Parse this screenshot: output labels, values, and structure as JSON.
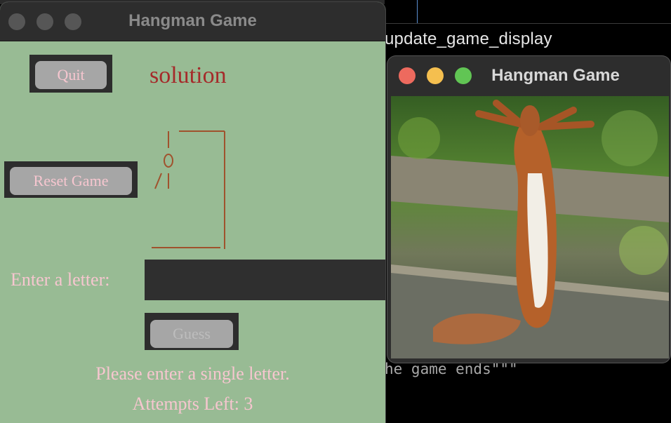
{
  "background": {
    "code_line_1": "update_game_display",
    "code_line_2": "he game ends\"\"\""
  },
  "window_left": {
    "title": "Hangman Game",
    "quit_label": "Quit",
    "solution_text": "solution",
    "reset_label": "Reset Game",
    "hangman_drawing": " |‾‾‾‾‾|\n |     |\n O     |\n/|     |\n       |\n       |\n‾‾‾‾‾‾‾‾",
    "enter_letter_label": "Enter a letter:",
    "letter_input_value": "",
    "guess_label": "Guess",
    "message": "Please enter a single letter.",
    "attempts_label": "Attempts Left: 3"
  },
  "window_right": {
    "title": "Hangman Game",
    "image_description_icon": "squirrel-photo"
  },
  "colors": {
    "window_bg": "#98bb94",
    "text_pink": "#f6c6cf",
    "solution_red": "#a52a2a",
    "gallows_brown": "#a0522d",
    "traffic_red": "#ed6a5e",
    "traffic_yellow": "#f5bf4f",
    "traffic_green": "#61c554"
  }
}
